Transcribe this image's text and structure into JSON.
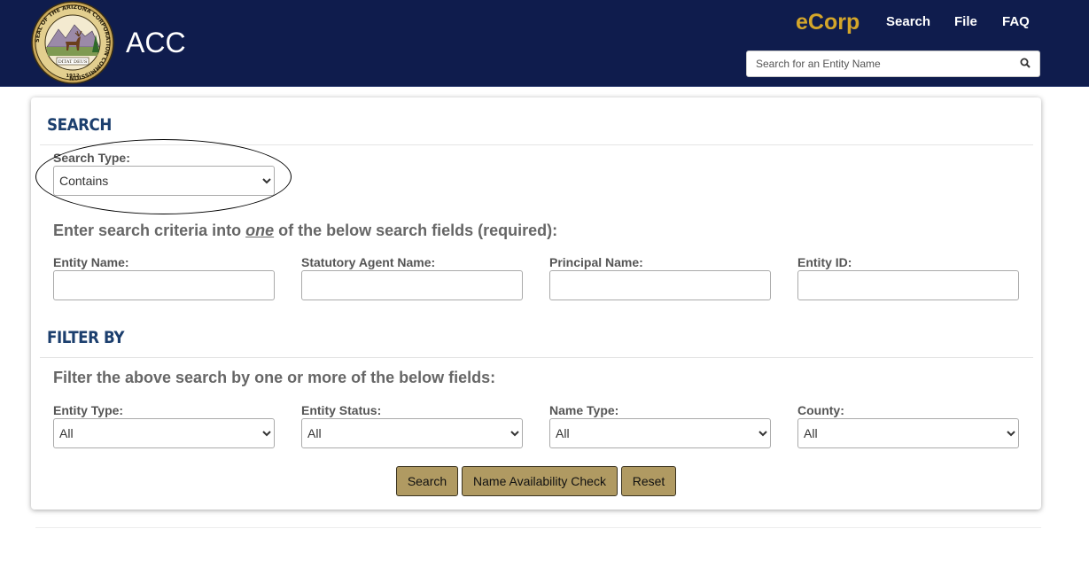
{
  "header": {
    "brand": "ACC",
    "nav": {
      "ecorp": "eCorp",
      "search": "Search",
      "file": "File",
      "faq": "FAQ"
    },
    "search_placeholder": "Search for an Entity Name",
    "seal_text": "SEAL OF THE ARIZONA CORPORATION COMMISSION",
    "seal_motto": "DITAT DEUS",
    "seal_year": "1912"
  },
  "search_section": {
    "title": "SEARCH",
    "search_type_label": "Search Type:",
    "search_type_value": "Contains",
    "instruction_before": "Enter search criteria into ",
    "instruction_emphasis": "one",
    "instruction_after": " of the below search fields (required):",
    "fields": {
      "entity_name": "Entity Name:",
      "statutory_agent_name": "Statutory Agent Name:",
      "principal_name": "Principal Name:",
      "entity_id": "Entity ID:"
    }
  },
  "filter_section": {
    "title": "FILTER BY",
    "instruction": "Filter the above search by one or more of the below fields:",
    "fields": {
      "entity_type": {
        "label": "Entity Type:",
        "value": "All"
      },
      "entity_status": {
        "label": "Entity Status:",
        "value": "All"
      },
      "name_type": {
        "label": "Name Type:",
        "value": "All"
      },
      "county": {
        "label": "County:",
        "value": "All"
      }
    }
  },
  "buttons": {
    "search": "Search",
    "name_availability": "Name Availability Check",
    "reset": "Reset"
  },
  "colors": {
    "header_bg": "#0f1c4d",
    "ecorp_gold": "#d4a62a",
    "section_title": "#1c3f6e",
    "button_bg": "#b09a62"
  },
  "icons": {
    "header_search": "search-icon",
    "seal": "arizona-seal-logo"
  }
}
